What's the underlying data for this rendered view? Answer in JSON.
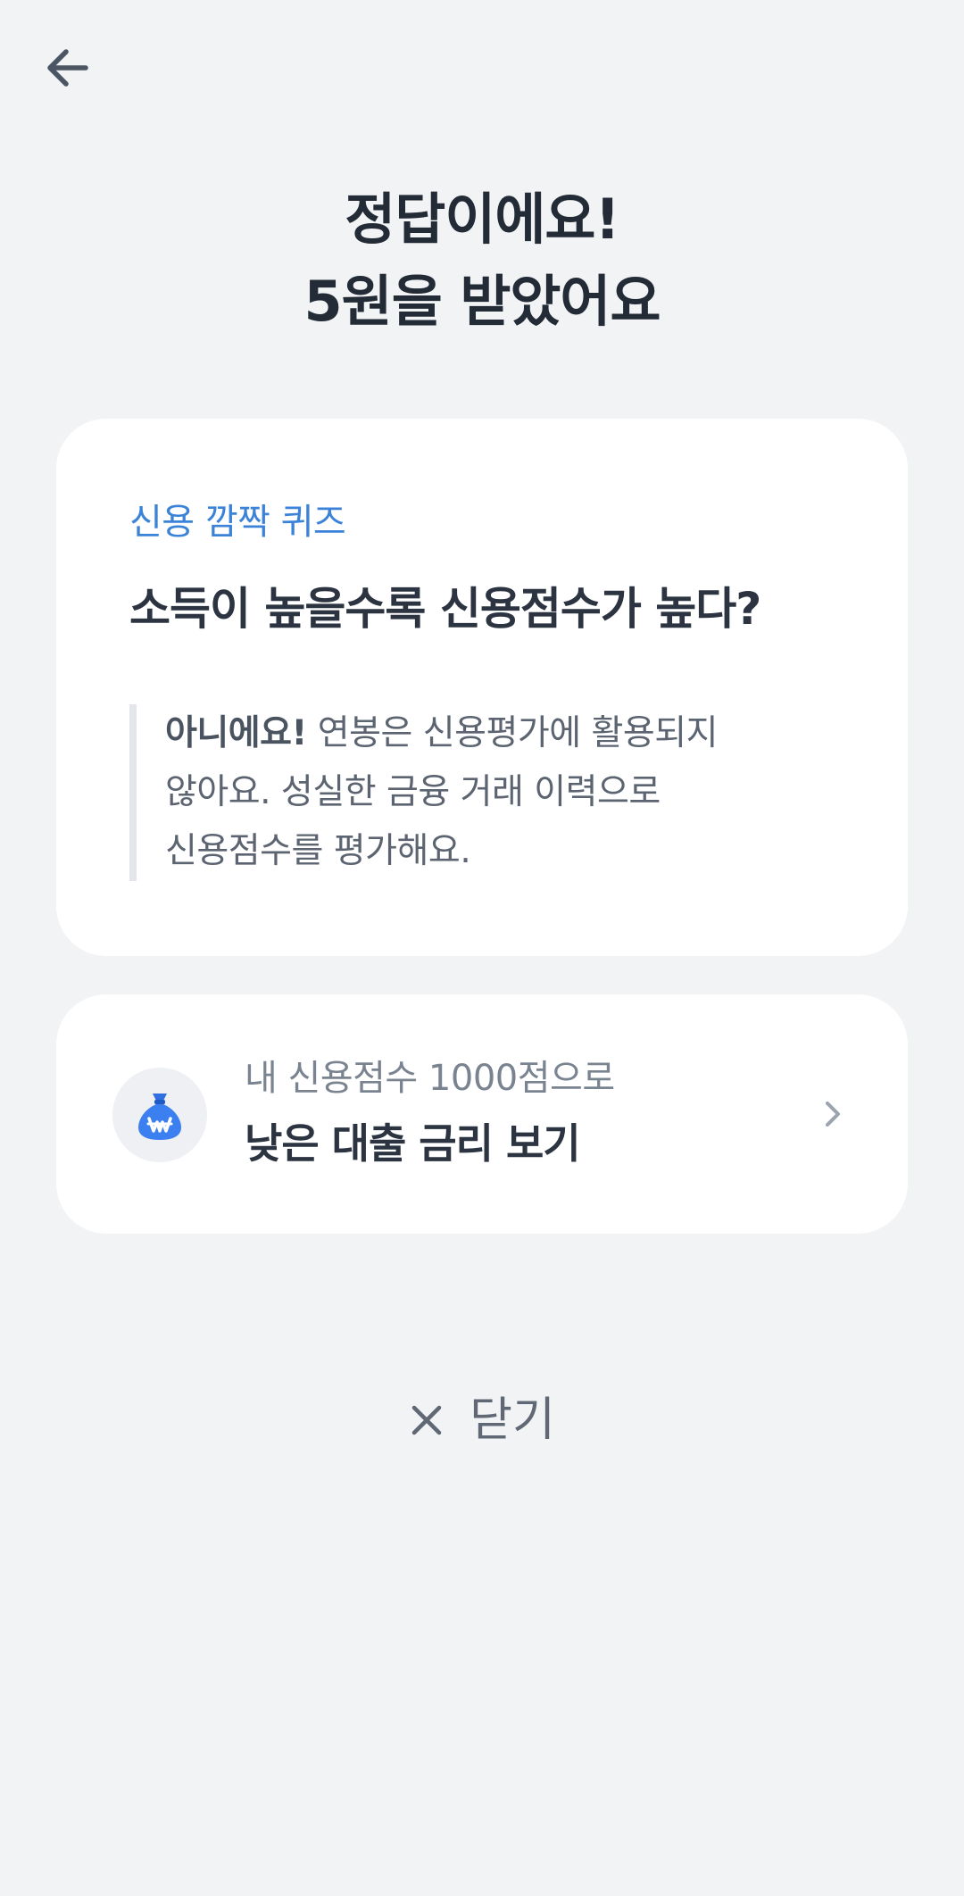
{
  "nav": {
    "back_icon": "arrow-left-icon"
  },
  "headline": {
    "line1": "정답이에요!",
    "line2": "5원을 받았어요"
  },
  "quiz": {
    "label": "신용 깜짝 퀴즈",
    "question": "소득이 높을수록 신용점수가 높다?",
    "answer_strong": "아니에요!",
    "answer_line1": " 연봉은 신용평가에 활용되지",
    "answer_line2": "않아요. 성실한 금융 거래 이력으로",
    "answer_line3": "신용점수를 평가해요."
  },
  "cta": {
    "icon": "money-bag-icon",
    "subtitle": "내 신용점수 1000점으로",
    "title": "낮은 대출 금리 보기",
    "chevron_icon": "chevron-right-icon"
  },
  "close": {
    "icon": "close-icon",
    "label": "닫기"
  },
  "colors": {
    "background": "#f2f3f5",
    "accent_blue": "#3b82d9",
    "card": "#ffffff",
    "text_dark": "#222b36",
    "text_muted": "#7a8491"
  }
}
